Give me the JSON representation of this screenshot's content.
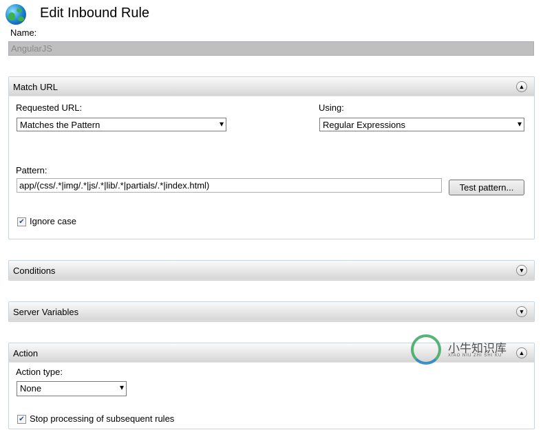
{
  "title": "Edit Inbound Rule",
  "icon": "globe-icon",
  "name": {
    "label": "Name:",
    "value": "AngularJS"
  },
  "match_url": {
    "header": "Match URL",
    "requested_label": "Requested URL:",
    "requested_value": "Matches the Pattern",
    "using_label": "Using:",
    "using_value": "Regular Expressions",
    "pattern_label": "Pattern:",
    "pattern_value": "app/(css/.*|img/.*|js/.*|lib/.*|partials/.*|index.html)",
    "test_button": "Test pattern...",
    "ignore_case_label": "Ignore case",
    "ignore_case": true
  },
  "conditions": {
    "header": "Conditions"
  },
  "server_variables": {
    "header": "Server Variables"
  },
  "action": {
    "header": "Action",
    "type_label": "Action type:",
    "type_value": "None",
    "stop_label": "Stop processing of subsequent rules",
    "stop": true
  },
  "watermark": {
    "text": "小牛知识库",
    "sub": "XIAO NIU ZHI SHI KU"
  }
}
